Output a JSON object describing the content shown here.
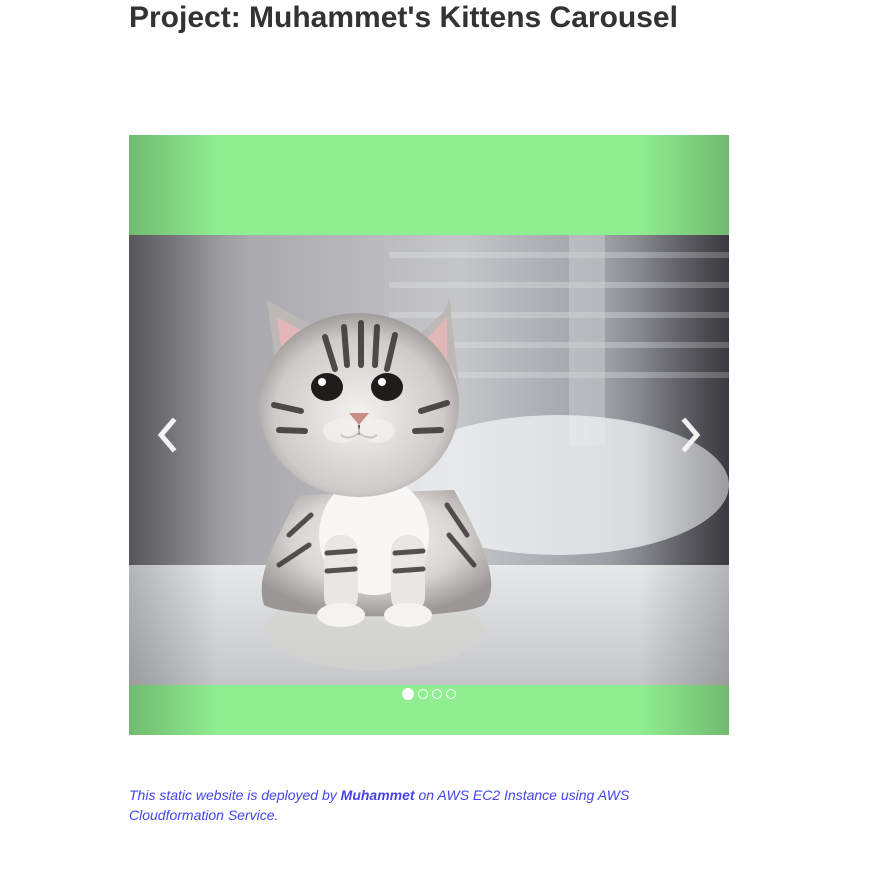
{
  "page": {
    "title": "Project: Muhammet's Kittens Carousel"
  },
  "carousel": {
    "background_color": "#90ee90",
    "prev_icon": "chevron-left-icon",
    "next_icon": "chevron-right-icon",
    "slide_count": 4,
    "active_slide": 1,
    "current_slide_subject": "tabby kitten sitting on a floor"
  },
  "footer": {
    "text_before": "This static website is deployed by ",
    "author": "Muhammet",
    "text_after": " on AWS EC2 Instance using AWS Cloudformation Service.",
    "color": "#4444ee"
  }
}
